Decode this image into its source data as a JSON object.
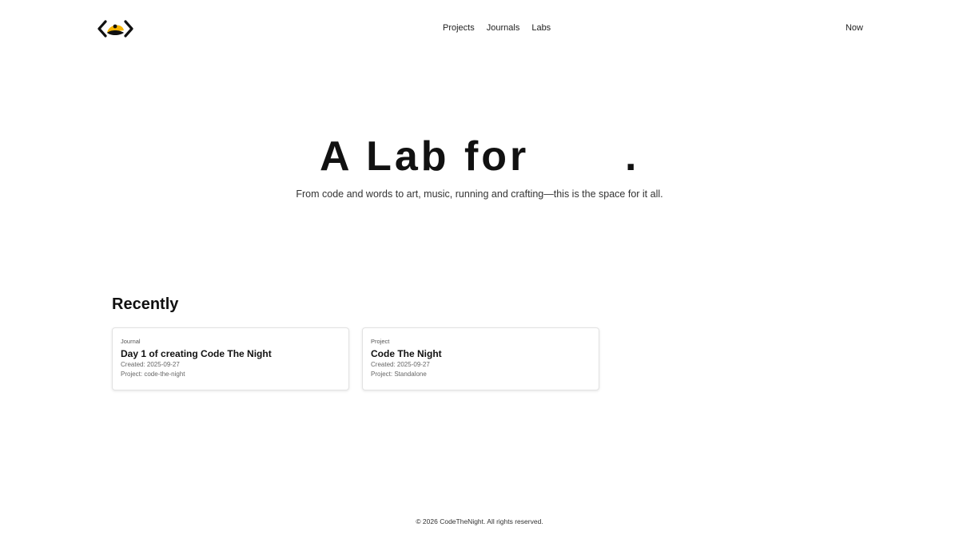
{
  "header": {
    "logo_alt": "CodeTheNight logo",
    "nav": [
      {
        "label": "Projects"
      },
      {
        "label": "Journals"
      },
      {
        "label": "Labs"
      }
    ],
    "now_label": "Now"
  },
  "hero": {
    "title": "A Lab for",
    "title_suffix": ".",
    "subtitle": "From code and words to art, music, running and crafting—this is the space for it all."
  },
  "recent": {
    "heading": "Recently",
    "cards": [
      {
        "type": "Journal",
        "title": "Day 1 of creating Code The Night",
        "created": "Created: 2025-09-27",
        "project": "Project: code-the-night"
      },
      {
        "type": "Project",
        "title": "Code The Night",
        "created": "Created: 2025-09-27",
        "project": "Project: Standalone"
      }
    ]
  },
  "footer": {
    "copyright": "© 2026 CodeTheNight. All rights reserved."
  },
  "colors": {
    "logo_yellow": "#f5b400",
    "logo_dark": "#111111",
    "text": "#111111"
  },
  "icons": {
    "logo": "code-brackets-eye-logo"
  }
}
